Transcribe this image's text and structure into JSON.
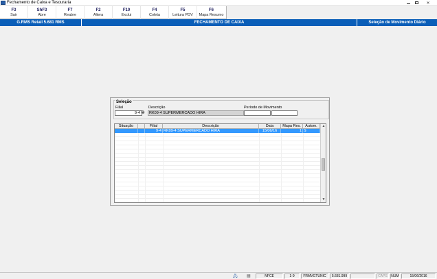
{
  "window": {
    "title": "Fechamento de Caixa e Tesouraria",
    "app_icon": "app-icon",
    "controls": [
      "minimize-icon",
      "maximize-icon",
      "close-icon"
    ]
  },
  "toolbar": [
    {
      "key": "F3",
      "label": "Sair"
    },
    {
      "key": "ShF3",
      "label": "Abre"
    },
    {
      "key": "F7",
      "label": "Reabre"
    },
    {
      "key": "F2",
      "label": "Altera"
    },
    {
      "key": "F10",
      "label": "Exclui"
    },
    {
      "key": "F4",
      "label": "Coleta"
    },
    {
      "key": "F5",
      "label": "Leitura PDV"
    },
    {
      "key": "F6",
      "label": "Mapa Resumo"
    }
  ],
  "header": {
    "left": "G.RMS Retail 5.681 RMS",
    "center": "FECHAMENTO DE CAIXA",
    "right": "Seleção de Movimento Diário",
    "color": "#0a5eb8"
  },
  "selecao": {
    "title": "Seleção",
    "filial_label": "Filial",
    "filial_value": "9-4",
    "search_icon": "binoculars-icon",
    "descricao_label": "Descrição",
    "descricao_value": "RK09-4 SUPERMERCADO HIRA",
    "periodo_label": "Período de Movimento",
    "periodo_inicio": "",
    "periodo_fim": ""
  },
  "grid": {
    "columns": [
      "Situação",
      "",
      "Filial",
      "Descrição",
      "Data",
      "Mapa Res.",
      "Autom."
    ],
    "rows": [
      {
        "situacao": "",
        "flag": "",
        "filial": "9-4",
        "descricao": "RK09-4 SUPERMERCADO HIRA",
        "data": "15/06/16",
        "mapa": "1",
        "autom": "S"
      }
    ],
    "selected_color": "#3399ff"
  },
  "statusbar": {
    "icons": [
      "network-icon",
      "document-icon"
    ],
    "panels": [
      "NFCE",
      "1-9",
      "FRMVGTUNIC",
      "5.681.999",
      "",
      "CAPS",
      "NUM",
      "15/06/2016"
    ]
  }
}
